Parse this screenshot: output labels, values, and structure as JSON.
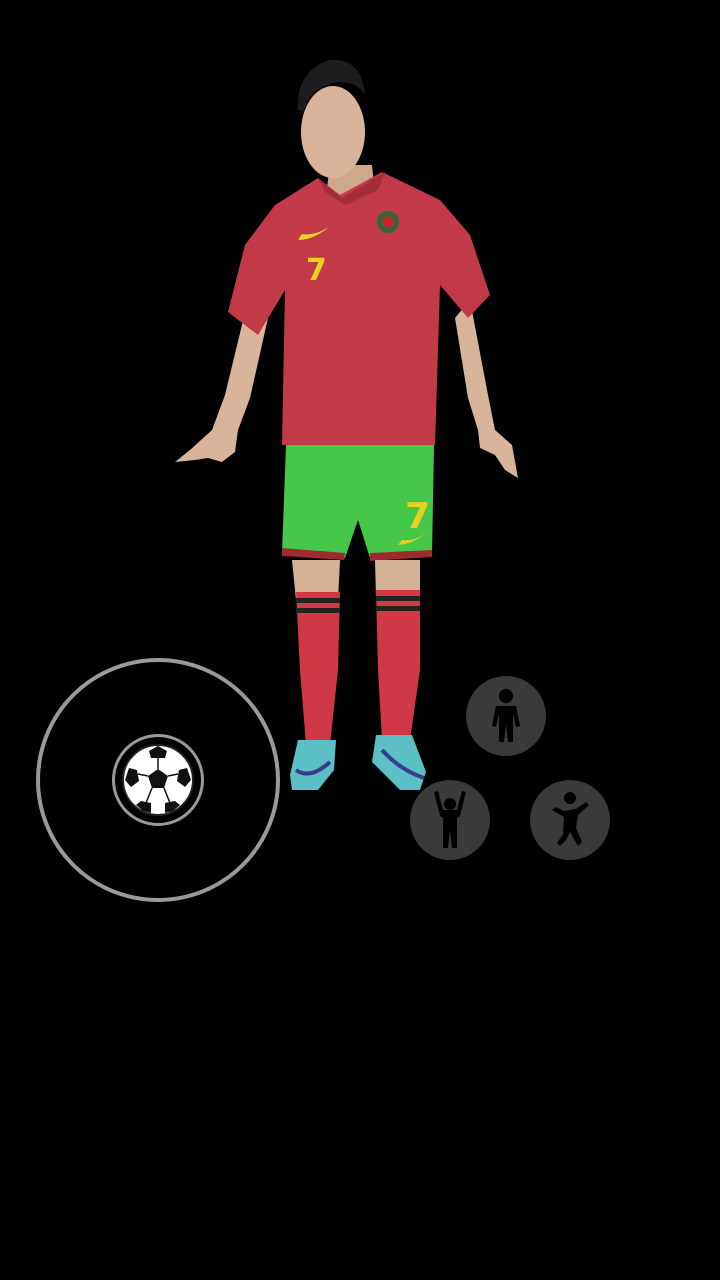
{
  "scene": {
    "background_color": "#000000",
    "player": {
      "shirt_number": "7",
      "shirt_color": "#c23a48",
      "shorts_color": "#45c84a",
      "number_color": "#e9d21e",
      "socks_color": "#d03846",
      "boots_color": "#5bc0c6"
    }
  },
  "controls": {
    "joystick": {
      "knob_icon": "soccer-ball-icon",
      "ring_color": "#9a9a9a"
    },
    "actions": [
      {
        "id": "stand",
        "icon": "standing-person-icon"
      },
      {
        "id": "celebrate",
        "icon": "arms-raised-person-icon"
      },
      {
        "id": "dance",
        "icon": "dancing-person-icon"
      }
    ],
    "button_color": "#3a3a3a",
    "icon_color": "#000000"
  }
}
